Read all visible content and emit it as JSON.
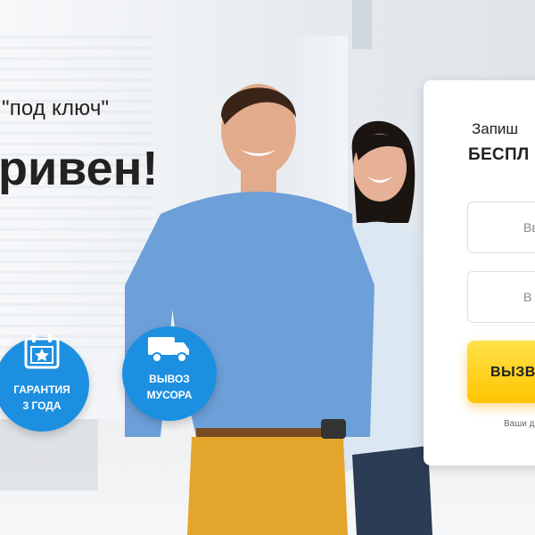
{
  "hero": {
    "subtitle": "\"под ключ\"",
    "title": "ривен!"
  },
  "badges": [
    {
      "label_line1": "ГАРАНТИЯ",
      "label_line2": "3 ГОДА",
      "icon": "calendar-star-icon"
    },
    {
      "label_line1": "ВЫВОЗ",
      "label_line2": "МУСОРА",
      "icon": "truck-icon"
    }
  ],
  "form": {
    "title_line1": "Запиш",
    "title_line2": "БЕСПЛ",
    "field1_placeholder": "Вв",
    "field2_placeholder": "В",
    "button_label": "ВЫЗВ",
    "note": "Ваши д"
  },
  "colors": {
    "badge_blue": "#1d8fe0",
    "button_yellow": "#ffcf1a",
    "text_dark": "#222222"
  }
}
